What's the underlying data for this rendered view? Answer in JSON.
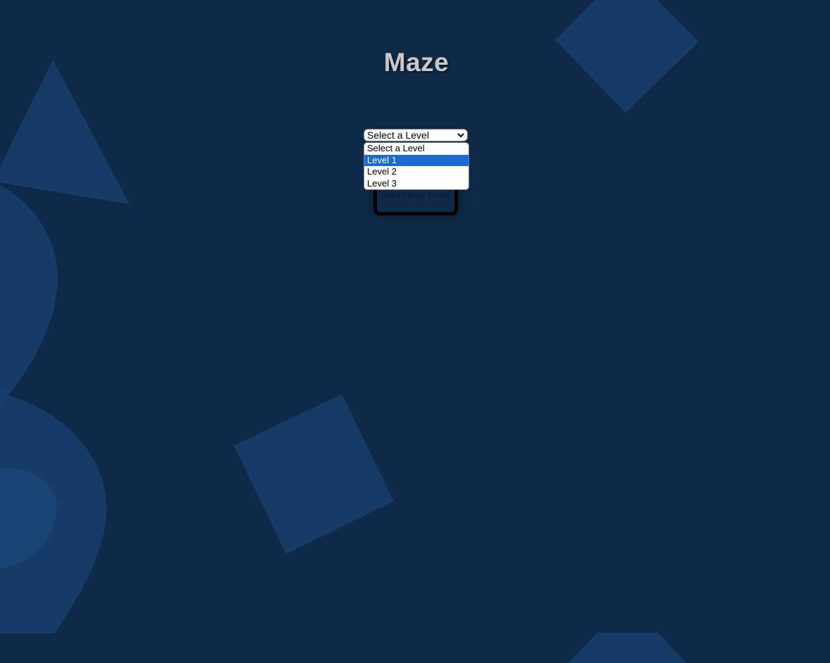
{
  "page": {
    "title": "Maze",
    "background_color": "#0f2a48",
    "shape_color": "#163e6c"
  },
  "level_select": {
    "current_value": "Select a Level",
    "icon": "chevron-down-icon",
    "options": [
      {
        "label": "Select a Level",
        "highlighted": false
      },
      {
        "label": "Level 1",
        "highlighted": true
      },
      {
        "label": "Level 2",
        "highlighted": false
      },
      {
        "label": "Level 3",
        "highlighted": false
      }
    ],
    "highlight_color": "#1a6bd6"
  },
  "maze_board": {
    "message": "Select your level!"
  }
}
